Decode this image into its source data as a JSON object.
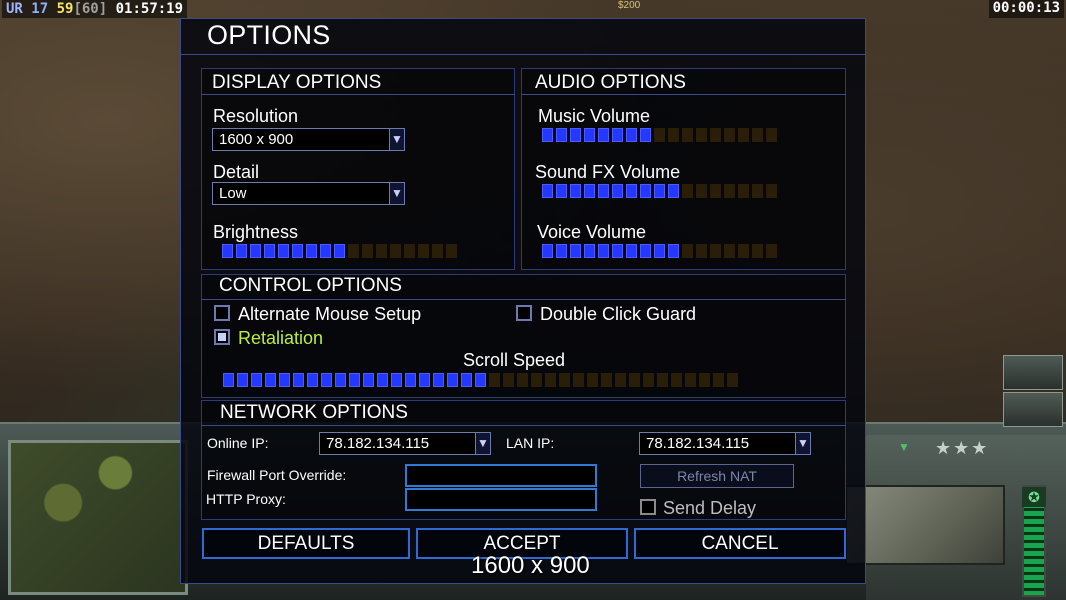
{
  "hud": {
    "ur": "UR",
    "n1": "17",
    "n2": "59",
    "n3": "[60]",
    "clock_left": "01:57:19",
    "clock_right": "00:00:13",
    "money": "$200"
  },
  "dialog": {
    "title": "OPTIONS",
    "display": {
      "heading": "DISPLAY OPTIONS",
      "resolution_label": "Resolution",
      "resolution_value": "1600 x 900",
      "detail_label": "Detail",
      "detail_value": "Low",
      "brightness_label": "Brightness",
      "brightness_level": 9,
      "brightness_max": 17
    },
    "audio": {
      "heading": "AUDIO OPTIONS",
      "music_label": "Music Volume",
      "music_level": 8,
      "music_max": 17,
      "sfx_label": "Sound FX Volume",
      "sfx_level": 10,
      "sfx_max": 17,
      "voice_label": "Voice Volume",
      "voice_level": 10,
      "voice_max": 17
    },
    "control": {
      "heading": "CONTROL OPTIONS",
      "alt_mouse_label": "Alternate Mouse Setup",
      "alt_mouse_checked": false,
      "double_click_label": "Double Click Guard",
      "double_click_checked": false,
      "retaliation_label": "Retaliation",
      "retaliation_checked": true,
      "scroll_label": "Scroll Speed",
      "scroll_level": 19,
      "scroll_max": 37
    },
    "network": {
      "heading": "NETWORK OPTIONS",
      "online_ip_label": "Online IP:",
      "online_ip_value": "78.182.134.115",
      "lan_ip_label": "LAN IP:",
      "lan_ip_value": "78.182.134.115",
      "firewall_label": "Firewall Port Override:",
      "firewall_value": "",
      "proxy_label": "HTTP Proxy:",
      "proxy_value": "",
      "refresh_nat_label": "Refresh NAT",
      "send_delay_label": "Send Delay",
      "send_delay_checked": false
    },
    "buttons": {
      "defaults": "DEFAULTS",
      "accept": "ACCEPT",
      "cancel": "CANCEL"
    },
    "overlay_resolution": "1600 x 900"
  },
  "colors": {
    "bar_on": "#2438ff",
    "bar_off": "#2a1e08",
    "border_accent": "#2f6ad3",
    "retaliation_green": "#b9f03a"
  }
}
